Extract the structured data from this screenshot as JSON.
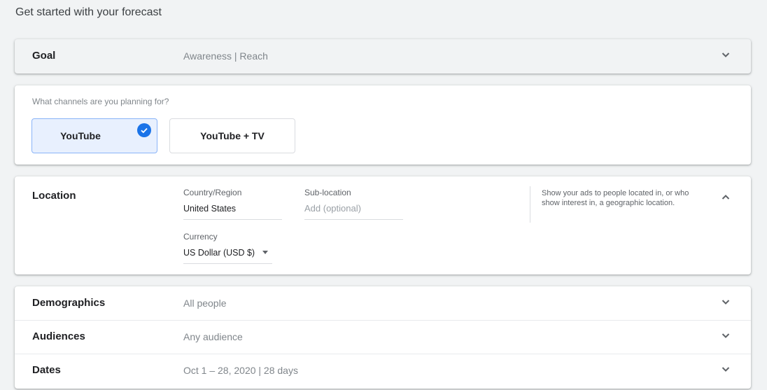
{
  "page": {
    "heading": "Get started with your forecast"
  },
  "goal": {
    "title": "Goal",
    "summary": "Awareness | Reach",
    "icon": "chevron-down-icon"
  },
  "channels": {
    "question": "What channels are you planning for?",
    "options": [
      {
        "label": "YouTube",
        "selected": true
      },
      {
        "label": "YouTube + TV",
        "selected": false
      }
    ],
    "accent": "#1a73e8"
  },
  "location": {
    "title": "Location",
    "country": {
      "label": "Country/Region",
      "value": "United States"
    },
    "sublocation": {
      "label": "Sub-location",
      "placeholder": "Add (optional)"
    },
    "currency": {
      "label": "Currency",
      "value": "US Dollar (USD $)"
    },
    "help": "Show your ads to people located in, or who show interest in, a geographic location.",
    "icon": "chevron-up-icon"
  },
  "sections": [
    {
      "title": "Demographics",
      "summary": "All people"
    },
    {
      "title": "Audiences",
      "summary": "Any audience"
    },
    {
      "title": "Dates",
      "summary": "Oct 1 – 28, 2020 | 28 days"
    }
  ]
}
